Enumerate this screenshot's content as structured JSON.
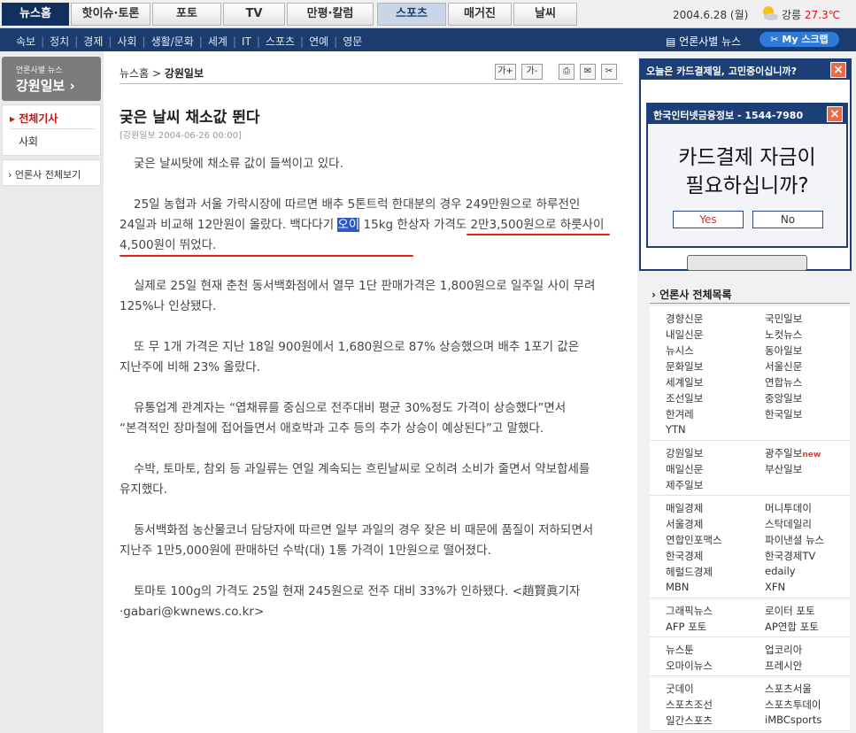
{
  "top_nav": {
    "tabs": [
      "뉴스홈",
      "핫이슈·토론",
      "포토",
      "TV",
      "만평·칼럼",
      "스포츠",
      "매거진",
      "날씨"
    ],
    "date": "2004.6.28 (월)",
    "weather_city": "강릉",
    "weather_temp": "27.3℃"
  },
  "sub_nav": {
    "items": [
      "속보",
      "정치",
      "경제",
      "사회",
      "생활/문화",
      "세계",
      "IT",
      "스포츠",
      "연예",
      "영문"
    ],
    "news_by_press": "언론사별 뉴스",
    "my_scrap": "My 스크랩"
  },
  "left_panel": {
    "small_label": "언론사별 뉴스",
    "press_name": "강원일보",
    "all_articles": "전체기사",
    "society": "사회",
    "all_press": "언론사 전체보기"
  },
  "content": {
    "breadcrumb_home": "뉴스홈",
    "breadcrumb_sep": ">",
    "breadcrumb_press": "강원일보",
    "tools": {
      "font_up": "가+",
      "font_down": "가-"
    },
    "title": "궂은 날씨 채소값 뛴다",
    "byline": "[강원일보 2004-06-26 00:00]",
    "paragraphs": [
      "궂은 날씨탓에 채소류 값이 들썩이고 있다.",
      "25일 농협과 서울 가락시장에 따르면 배추 5톤트럭 한대분의 경우 249만원으로 하루전인 24일과 비교해 12만원이 올랐다. 백다다기 오이 15kg 한상자 가격도 2만3,500원으로 하룻사이 4,500원이 뛰었다.",
      "실제로 25일 현재 춘천 동서백화점에서 열무 1단 판매가격은 1,800원으로 일주일 사이 무려 125%나 인상됐다.",
      "또 무 1개 가격은 지난 18일 900원에서 1,680원으로 87% 상승했으며 배추 1포기 값은 지난주에 비해 23% 올랐다.",
      "유통업계 관계자는 “엽채류를 중심으로 전주대비 평균 30%정도 가격이 상승했다”면서 “본격적인 장마철에 접어들면서 애호박과 고추 등의 추가 상승이 예상된다”고 말했다.",
      "수박, 토마토, 참외 등 과일류는 연일 계속되는 흐린날씨로 오히려 소비가 줄면서 약보합세를 유지했다.",
      "동서백화점 농산물코너 담당자에 따르면 일부 과일의 경우 잦은 비 때문에 품질이 저하되면서 지난주 1만5,000원에 판매하던 수박(대) 1통 가격이 1만원으로 떨어졌다.",
      "토마토 100g의 가격도 25일 현재 245원으로 전주 대비 33%가 인하됐다. <趙賢眞기자·gabari@kwnews.co.kr>"
    ],
    "p2_before": "25일 농협과 서울 가락시장에 따르면 배추 5톤트럭 한대분의 경우 249만원으로 하루전인 24일과 비교해 12만원이 올랐다. 백다다기 ",
    "p2_highlight": "오이",
    "p2_after": " 15kg 한상자 가격도 2만3,500원으로 하룻사이 4,500원이 뛰었다."
  },
  "ad": {
    "banner_title": "오늘은 카드결제일, 고민중이십니까?",
    "popup_title": "한국인터넷금융정보 - 1544-7980",
    "popup_line1": "카드결제 자금이",
    "popup_line2": "필요하십니까?",
    "yes": "Yes",
    "no": "No"
  },
  "press_list": {
    "heading": "언론사 전체목록",
    "groups": [
      [
        [
          "경향신문",
          "국민일보"
        ],
        [
          "내일신문",
          "노컷뉴스"
        ],
        [
          "뉴시스",
          "동아일보"
        ],
        [
          "문화일보",
          "서울신문"
        ],
        [
          "세계일보",
          "연합뉴스"
        ],
        [
          "조선일보",
          "중앙일보"
        ],
        [
          "한겨레",
          "한국일보"
        ],
        [
          "YTN",
          ""
        ]
      ],
      [
        [
          "강원일보",
          "광주일보"
        ],
        [
          "매일신문",
          "부산일보"
        ],
        [
          "제주일보",
          ""
        ]
      ],
      [
        [
          "매일경제",
          "머니투데이"
        ],
        [
          "서울경제",
          "스탁데일리"
        ],
        [
          "연합인포맥스",
          "파이낸셜 뉴스"
        ],
        [
          "한국경제",
          "한국경제TV"
        ],
        [
          "헤럴드경제",
          "edaily"
        ],
        [
          "MBN",
          "XFN"
        ]
      ],
      [
        [
          "그래픽뉴스",
          "로이터 포토"
        ],
        [
          "AFP 포토",
          "AP연합 포토"
        ]
      ],
      [
        [
          "뉴스툰",
          "업코리아"
        ],
        [
          "오마이뉴스",
          "프레시안"
        ]
      ],
      [
        [
          "굿데이",
          "스포츠서울"
        ],
        [
          "스포츠조선",
          "스포츠투데이"
        ],
        [
          "일간스포츠",
          "iMBCsports"
        ]
      ]
    ],
    "new_tag": "new"
  },
  "colors": {
    "nav_dark": "#1b3c6e",
    "highlight": "#2f58c8",
    "red_underline": "#e21111",
    "temp_red": "#dd1111"
  }
}
